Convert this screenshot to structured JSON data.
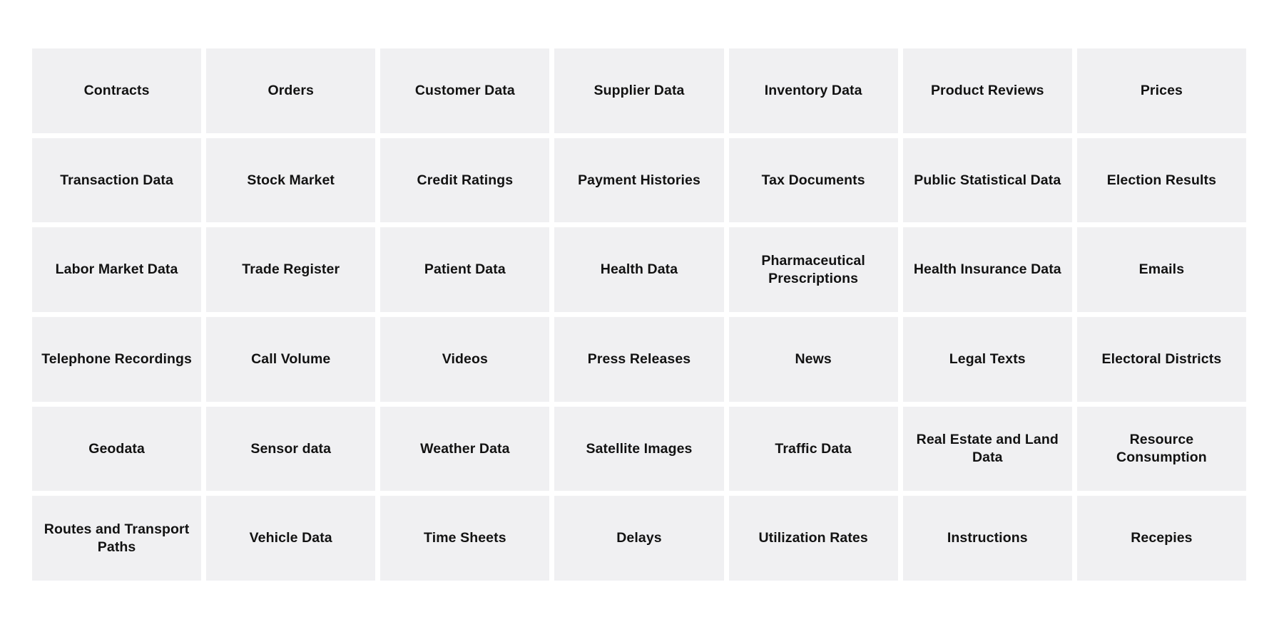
{
  "page": {
    "background_color": "#ffffff",
    "tile_color": "#f0f0f2",
    "text_color": "#121212",
    "columns": 7,
    "rows": 6
  },
  "grid": {
    "cells": [
      {
        "label": "Contracts"
      },
      {
        "label": "Orders"
      },
      {
        "label": "Customer Data"
      },
      {
        "label": "Supplier Data"
      },
      {
        "label": "Inventory Data"
      },
      {
        "label": "Product Reviews"
      },
      {
        "label": "Prices"
      },
      {
        "label": "Transaction Data"
      },
      {
        "label": "Stock Market"
      },
      {
        "label": "Credit Ratings"
      },
      {
        "label": "Payment Histories"
      },
      {
        "label": "Tax Documents"
      },
      {
        "label": "Public Statistical Data"
      },
      {
        "label": "Election Results"
      },
      {
        "label": "Labor Market Data"
      },
      {
        "label": "Trade Register"
      },
      {
        "label": "Patient Data"
      },
      {
        "label": "Health Data"
      },
      {
        "label": "Pharmaceutical Prescriptions"
      },
      {
        "label": "Health Insurance Data"
      },
      {
        "label": "Emails"
      },
      {
        "label": "Telephone Recordings"
      },
      {
        "label": "Call Volume"
      },
      {
        "label": "Videos"
      },
      {
        "label": "Press Releases"
      },
      {
        "label": "News"
      },
      {
        "label": "Legal Texts"
      },
      {
        "label": "Electoral Districts"
      },
      {
        "label": "Geodata"
      },
      {
        "label": "Sensor data"
      },
      {
        "label": "Weather Data"
      },
      {
        "label": "Satellite Images"
      },
      {
        "label": "Traffic Data"
      },
      {
        "label": "Real Estate and Land Data"
      },
      {
        "label": "Resource Consumption"
      },
      {
        "label": "Routes and Transport Paths"
      },
      {
        "label": "Vehicle Data"
      },
      {
        "label": "Time Sheets"
      },
      {
        "label": "Delays"
      },
      {
        "label": "Utilization Rates"
      },
      {
        "label": "Instructions"
      },
      {
        "label": "Recepies"
      }
    ]
  }
}
